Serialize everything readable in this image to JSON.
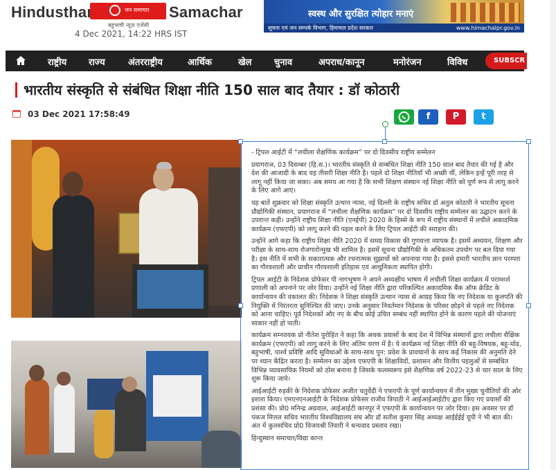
{
  "header": {
    "brand_left": "Hindusthan",
    "brand_right": "Samachar",
    "brand_logo_text": "जन समाचार",
    "brand_tagline": "बहुभाषी न्यूज़ एजेंसी",
    "dateline": "4 Dec 2021, 14:22 HRS IST"
  },
  "banner": {
    "headline": "स्वस्थ और सुरक्षित त्योहार मनाएं",
    "footer": "सूचना एवं जन सम्पर्क विभाग, हिमाचल प्रदेश सरकार",
    "site": "www.himachalpr.gov.in"
  },
  "nav": {
    "home_icon": "home-icon",
    "items": [
      "राष्ट्रीय",
      "राज्य",
      "अंतरराष्ट्रीय",
      "आर्थिक",
      "खेल",
      "चुनाव",
      "अपराध/कानून",
      "मनोरंजन",
      "विविध"
    ],
    "subscribe": "SUBSCR"
  },
  "article": {
    "title": "भारतीय संस्कृति से संबंधित शिक्षा नीति 150 साल बाद तैयार : डॉ कोठारी",
    "published": "03 Dec 2021 17:58:49",
    "share": {
      "whatsapp": "whatsapp-icon",
      "facebook": "f",
      "pinterest": "P",
      "twitter": "t"
    },
    "paragraphs": [
      "- ट्रिपल आईटी में “लचीला शैक्षणिक कार्यक्रम” पर दो दिवसीय राष्ट्रीय सम्मेलन",
      "प्रयागराज, 03 दिसम्बर (हि.स.)। भारतीय संस्कृति से सम्बंधित शिक्षा नीति 150 साल बाद तैयार की गई है और देश की आजादी के बाद यह तीसरी शिक्षा नीति है। पहले दो शिक्षा नीतियाँ भी अच्छी थीं, लेकिन इन्हें पूरी तरह से लागू नहीं किया जा सका। अब समय आ गया है कि सभी शिक्षण संस्थान नई शिक्षा नीति को पूर्ण रूप से लागू करने के लिए आगे आएं।",
      "यह बातें शुक्रवार को शिक्षा संस्कृति उत्थान न्यास, नई दिल्ली के राष्ट्रीय सचिव डॉ अतुल कोठारी ने भारतीय सूचना प्रौद्योगिकी संस्थान, प्रयागराज में “लचीला शैक्षणिक कार्यक्रम” पर दो दिवसीय राष्ट्रीय सम्मेलन का उद्घाटन करने के उपरान्त कही। उन्होंने राष्ट्रीय शिक्षा नीति (एनईपी) 2020 के हिस्से के रूप में राष्ट्रीय संस्थानों में लचीले अकादमिक कार्यक्रम (एफएपी) को लागू करने की पहल करने के लिए ट्रिपल आईटी की सराहना की।",
      "उन्होंने आगे कहा कि राष्ट्रीय शिक्षा नीति 2020 में समग्र विकास की गुणवत्ता व्यापक है। इसमें अध्ययन, शिक्षण और परीक्षा के साथ-साथ रोजगारोन्मुख भी शामिल है। इसमें सूचना प्रौद्योगिकी के अधिकतम उपयोग पर बल दिया गया है। इस नीति में सभी के सकारात्मक और रचनात्मक सुझावों को अपनाया गया है। इससे हमारी भारतीय ज्ञान परम्परा का गौरवशाली और प्राचीन गौरवशाली इतिहास एवं आधुनिकता स्थापित होगी।",
      "ट्रिपल आईटी के निदेशक प्रोफेसर पी नागभूषण ने अपने अध्यक्षीय भाषण में लचीली शिक्षा कार्यक्रम में पराम्शर्श प्रणाली को अपनाने पर जोर दिया। उन्होंने नई शिक्षा नीति द्वारा परिकल्पित अकादमिक बैंक ऑफ क्रेडिट के कार्यान्वयन की वकालत की। निदेशक ने शिक्षा संस्कृति उत्थान न्यास से आग्रह किया कि नए निदेशक या कुलपति की नियुक्ति में निरंतरता सुनिश्चित की जाए। उनके अनुसार निवर्तमान निदेशक के परिसर छोड़ने से पहले नए निदेशक को आना चाहिए। पूर्व निदेशकों और नए के बीच कोई उचित सम्बंध नहीं स्थापित होने के कारण पहले की योजनाएं साकार नहीं हो पाती।",
      "कार्यक्रम सम्नवयक प्रो नीतेश पुरोहित ने कहा कि अथक प्रयासों के बाद देश में विभिन्न संस्थानों द्वारा लचीला शैक्षिक कार्यक्रम (एफएपी) को लागू करने के लिए अंतिम चरण में है। ये कार्यक्रम नई शिक्षा नीति की बहु-विषयक, बहु-मोड, बहुभाषी, पार्श्व प्रविष्टि आदि सुविधाओं के साथ-साथ पुन: प्रवेश के प्रावधानों के साथ कई निकास की अनुमति देने पर ध्यान केंद्रित करता है। सम्मेलन का उद्देश्य एफएपी के शिक्षाविदों, प्रशासन और वित्तीय पहलुओं से सम्बंधित विभिन्न व्यावसायिक नियमों को ठोस बनाना है जिसके फलस्वरूप इसे शैक्षणिक वर्ष 2022-23 से चार साल के लिए शुरू किया जाये।",
      "आईआईटी रुड़की के निदेशक प्रोफेसर अजीत चतुर्वेदी ने एफएपी के पूर्ण कार्यान्वयन में तीन मुख्य चुनौतियों की ओर इशारा किया। एमएनएनआईटी के निदेशक प्रोफेसर राजीव त्रिपाठी ने आईआईआईटीए द्वारा किए गए प्रयासों की प्रशंसा की। प्रो0 मनिन्द्र अग्रवाल, आईआईटी कानपुर ने एफएपी के कार्यान्वयन पर जोर दिया। इस अवसर पर डॉ पंकज मित्तल सचिव भारतीय विश्वविद्यालय संघ और डॉ सतीश कुमार सिंह अध्यक्ष आईईईई यूपी ने भी बात की। अंत में कुलसचिव प्रो0 विजयश्री तिवारी ने धन्यवाद प्रस्ताव रखा।"
    ],
    "signature": "हिन्दुस्थान समाचार/विद्या कान्त"
  }
}
